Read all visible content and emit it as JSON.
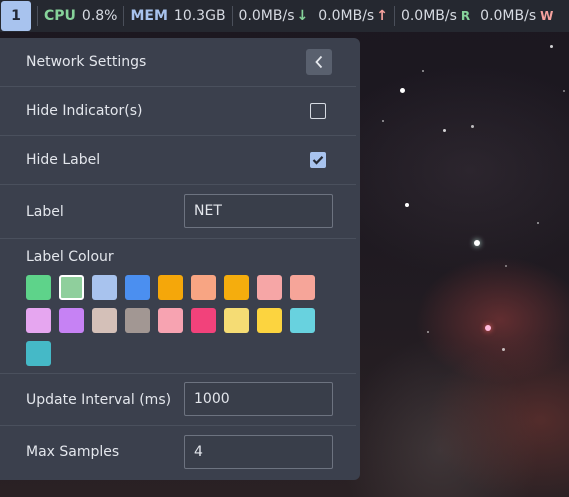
{
  "topbar": {
    "workspace": "1",
    "cpu_label": "CPU",
    "cpu_value": "0.8%",
    "mem_label": "MEM",
    "mem_value": "10.3GB",
    "net_down": "0.0MB/s",
    "net_down_arrow": "↓",
    "net_up": "0.0MB/s",
    "net_up_arrow": "↑",
    "disk_read": "0.0MB/s",
    "disk_read_label": "R",
    "disk_write": "0.0MB/s",
    "disk_write_label": "W"
  },
  "panel": {
    "title": "Network Settings",
    "back_icon": "chevron-left-icon",
    "hide_indicators_label": "Hide Indicator(s)",
    "hide_indicators_checked": false,
    "hide_label_label": "Hide Label",
    "hide_label_checked": true,
    "label_label": "Label",
    "label_value": "NET",
    "colour_title": "Label Colour",
    "swatches": [
      {
        "color": "#5ed38a",
        "selected": false
      },
      {
        "color": "#8fcf9c",
        "selected": true
      },
      {
        "color": "#a8c3ee",
        "selected": false
      },
      {
        "color": "#4b8ff0",
        "selected": false
      },
      {
        "color": "#f5a70a",
        "selected": false
      },
      {
        "color": "#f8a583",
        "selected": false
      },
      {
        "color": "#f5ad0d",
        "selected": false
      },
      {
        "color": "#f6a6a6",
        "selected": false
      },
      {
        "color": "#f6a599",
        "selected": false
      },
      {
        "color": "#e6a6f0",
        "selected": false
      },
      {
        "color": "#c682f4",
        "selected": false
      },
      {
        "color": "#d4c0b8",
        "selected": false
      },
      {
        "color": "#a29793",
        "selected": false
      },
      {
        "color": "#f7a3b1",
        "selected": false
      },
      {
        "color": "#f2427b",
        "selected": false
      },
      {
        "color": "#f5dc74",
        "selected": false
      },
      {
        "color": "#fcd43f",
        "selected": false
      },
      {
        "color": "#68d2df",
        "selected": false
      },
      {
        "color": "#45b9c7",
        "selected": false
      }
    ],
    "update_interval_label": "Update Interval (ms)",
    "update_interval_value": "1000",
    "max_samples_label": "Max Samples",
    "max_samples_value": "4"
  },
  "colors": {
    "accent": "#a8c3ee",
    "panel_bg": "#3b404d",
    "topbar_bg": "#252830"
  }
}
